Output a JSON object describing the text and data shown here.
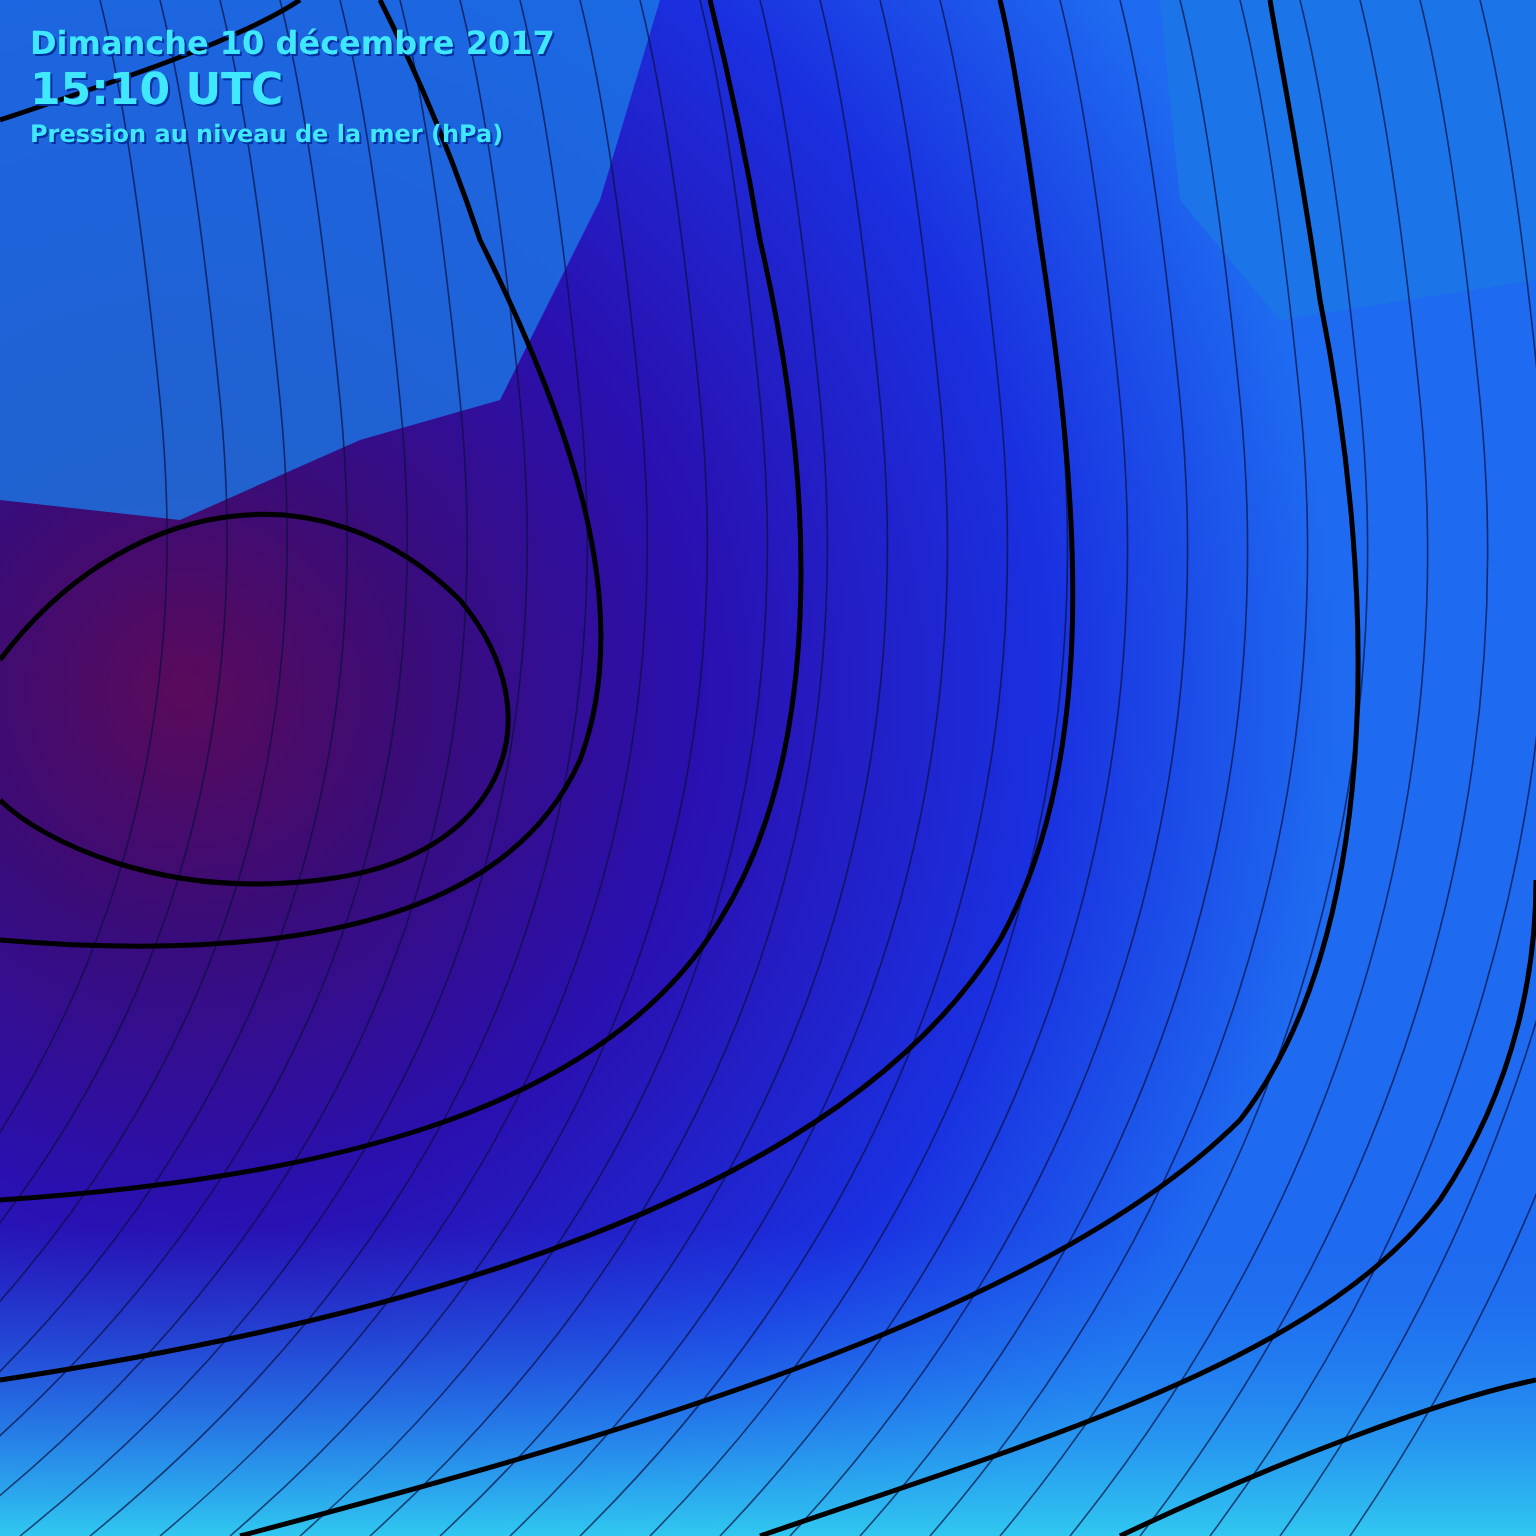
{
  "header": {
    "date": "Dimanche 10 décembre 2017",
    "time": "15:10 UTC",
    "subtitle": "Pression au niveau de la mer (hPa)"
  }
}
